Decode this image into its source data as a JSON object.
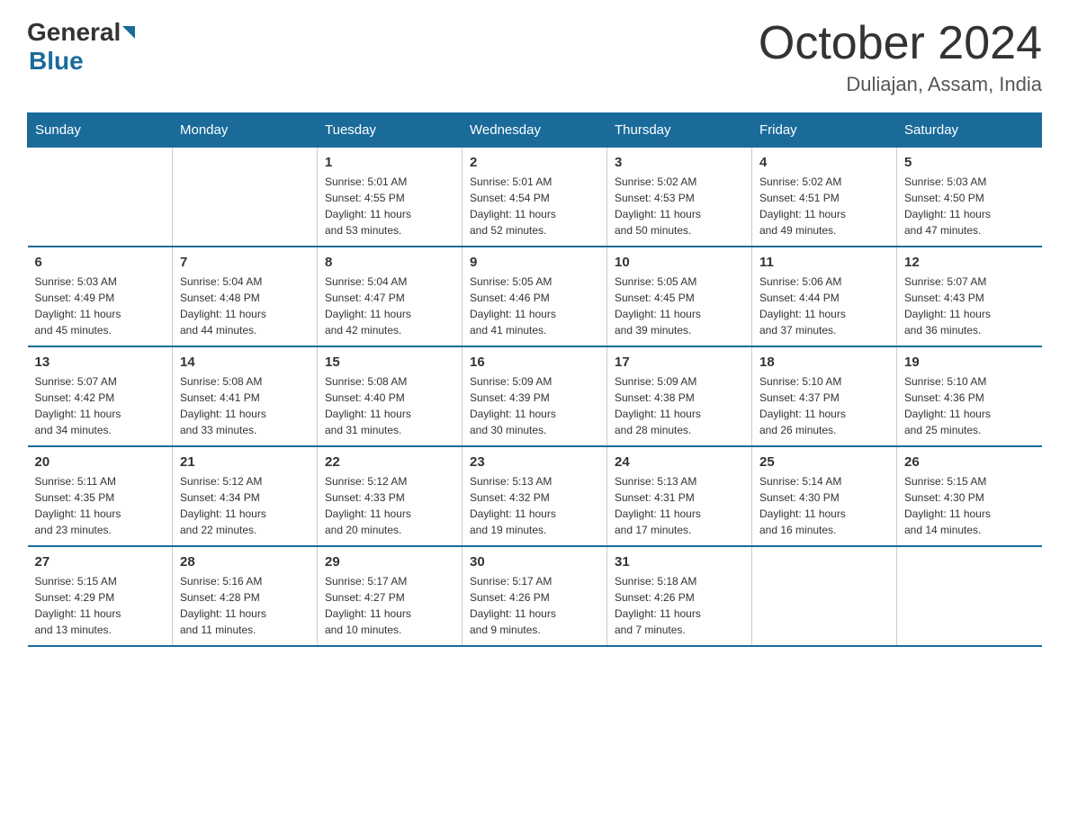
{
  "logo": {
    "general": "General",
    "blue": "Blue"
  },
  "header": {
    "month_year": "October 2024",
    "location": "Duliajan, Assam, India"
  },
  "weekdays": [
    "Sunday",
    "Monday",
    "Tuesday",
    "Wednesday",
    "Thursday",
    "Friday",
    "Saturday"
  ],
  "weeks": [
    [
      {
        "day": "",
        "info": ""
      },
      {
        "day": "",
        "info": ""
      },
      {
        "day": "1",
        "info": "Sunrise: 5:01 AM\nSunset: 4:55 PM\nDaylight: 11 hours\nand 53 minutes."
      },
      {
        "day": "2",
        "info": "Sunrise: 5:01 AM\nSunset: 4:54 PM\nDaylight: 11 hours\nand 52 minutes."
      },
      {
        "day": "3",
        "info": "Sunrise: 5:02 AM\nSunset: 4:53 PM\nDaylight: 11 hours\nand 50 minutes."
      },
      {
        "day": "4",
        "info": "Sunrise: 5:02 AM\nSunset: 4:51 PM\nDaylight: 11 hours\nand 49 minutes."
      },
      {
        "day": "5",
        "info": "Sunrise: 5:03 AM\nSunset: 4:50 PM\nDaylight: 11 hours\nand 47 minutes."
      }
    ],
    [
      {
        "day": "6",
        "info": "Sunrise: 5:03 AM\nSunset: 4:49 PM\nDaylight: 11 hours\nand 45 minutes."
      },
      {
        "day": "7",
        "info": "Sunrise: 5:04 AM\nSunset: 4:48 PM\nDaylight: 11 hours\nand 44 minutes."
      },
      {
        "day": "8",
        "info": "Sunrise: 5:04 AM\nSunset: 4:47 PM\nDaylight: 11 hours\nand 42 minutes."
      },
      {
        "day": "9",
        "info": "Sunrise: 5:05 AM\nSunset: 4:46 PM\nDaylight: 11 hours\nand 41 minutes."
      },
      {
        "day": "10",
        "info": "Sunrise: 5:05 AM\nSunset: 4:45 PM\nDaylight: 11 hours\nand 39 minutes."
      },
      {
        "day": "11",
        "info": "Sunrise: 5:06 AM\nSunset: 4:44 PM\nDaylight: 11 hours\nand 37 minutes."
      },
      {
        "day": "12",
        "info": "Sunrise: 5:07 AM\nSunset: 4:43 PM\nDaylight: 11 hours\nand 36 minutes."
      }
    ],
    [
      {
        "day": "13",
        "info": "Sunrise: 5:07 AM\nSunset: 4:42 PM\nDaylight: 11 hours\nand 34 minutes."
      },
      {
        "day": "14",
        "info": "Sunrise: 5:08 AM\nSunset: 4:41 PM\nDaylight: 11 hours\nand 33 minutes."
      },
      {
        "day": "15",
        "info": "Sunrise: 5:08 AM\nSunset: 4:40 PM\nDaylight: 11 hours\nand 31 minutes."
      },
      {
        "day": "16",
        "info": "Sunrise: 5:09 AM\nSunset: 4:39 PM\nDaylight: 11 hours\nand 30 minutes."
      },
      {
        "day": "17",
        "info": "Sunrise: 5:09 AM\nSunset: 4:38 PM\nDaylight: 11 hours\nand 28 minutes."
      },
      {
        "day": "18",
        "info": "Sunrise: 5:10 AM\nSunset: 4:37 PM\nDaylight: 11 hours\nand 26 minutes."
      },
      {
        "day": "19",
        "info": "Sunrise: 5:10 AM\nSunset: 4:36 PM\nDaylight: 11 hours\nand 25 minutes."
      }
    ],
    [
      {
        "day": "20",
        "info": "Sunrise: 5:11 AM\nSunset: 4:35 PM\nDaylight: 11 hours\nand 23 minutes."
      },
      {
        "day": "21",
        "info": "Sunrise: 5:12 AM\nSunset: 4:34 PM\nDaylight: 11 hours\nand 22 minutes."
      },
      {
        "day": "22",
        "info": "Sunrise: 5:12 AM\nSunset: 4:33 PM\nDaylight: 11 hours\nand 20 minutes."
      },
      {
        "day": "23",
        "info": "Sunrise: 5:13 AM\nSunset: 4:32 PM\nDaylight: 11 hours\nand 19 minutes."
      },
      {
        "day": "24",
        "info": "Sunrise: 5:13 AM\nSunset: 4:31 PM\nDaylight: 11 hours\nand 17 minutes."
      },
      {
        "day": "25",
        "info": "Sunrise: 5:14 AM\nSunset: 4:30 PM\nDaylight: 11 hours\nand 16 minutes."
      },
      {
        "day": "26",
        "info": "Sunrise: 5:15 AM\nSunset: 4:30 PM\nDaylight: 11 hours\nand 14 minutes."
      }
    ],
    [
      {
        "day": "27",
        "info": "Sunrise: 5:15 AM\nSunset: 4:29 PM\nDaylight: 11 hours\nand 13 minutes."
      },
      {
        "day": "28",
        "info": "Sunrise: 5:16 AM\nSunset: 4:28 PM\nDaylight: 11 hours\nand 11 minutes."
      },
      {
        "day": "29",
        "info": "Sunrise: 5:17 AM\nSunset: 4:27 PM\nDaylight: 11 hours\nand 10 minutes."
      },
      {
        "day": "30",
        "info": "Sunrise: 5:17 AM\nSunset: 4:26 PM\nDaylight: 11 hours\nand 9 minutes."
      },
      {
        "day": "31",
        "info": "Sunrise: 5:18 AM\nSunset: 4:26 PM\nDaylight: 11 hours\nand 7 minutes."
      },
      {
        "day": "",
        "info": ""
      },
      {
        "day": "",
        "info": ""
      }
    ]
  ]
}
